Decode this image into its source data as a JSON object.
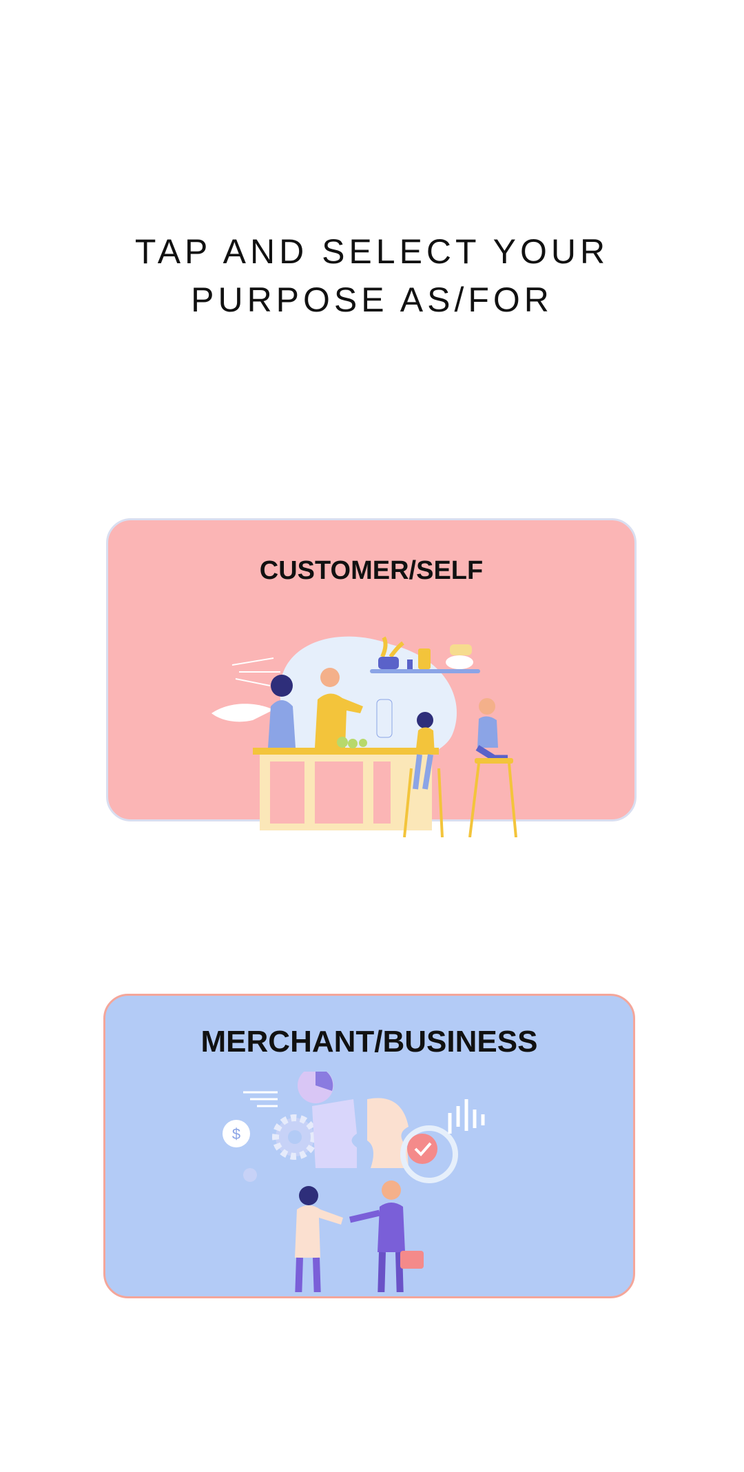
{
  "heading": {
    "line1": "TAP AND SELECT YOUR",
    "line2": "PURPOSE AS/FOR"
  },
  "options": {
    "customer": {
      "label": "CUSTOMER/SELF",
      "icon": "family-kitchen-illustration",
      "background": "#fbb5b5"
    },
    "merchant": {
      "label": "MERCHANT/BUSINESS",
      "icon": "business-handshake-illustration",
      "background": "#b3cbf6"
    }
  }
}
